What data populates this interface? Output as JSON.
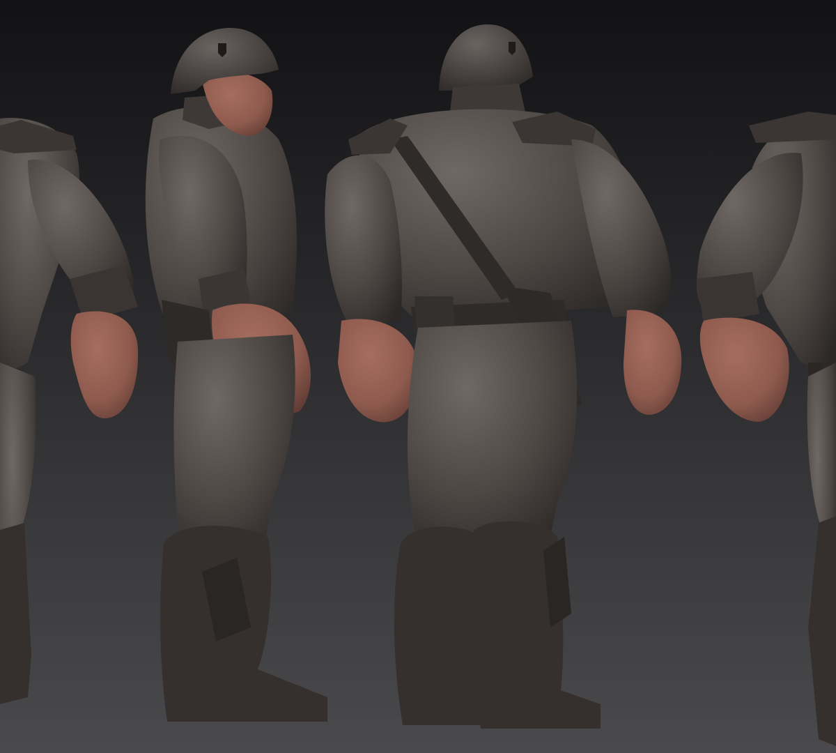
{
  "scene": {
    "background_top": "#121214",
    "background_bottom": "#4a4a4d",
    "uniform_color": "#4e4845",
    "uniform_highlight": "#6f6864",
    "uniform_shadow": "#2c2826",
    "skin_color": "#8f5b4e",
    "skin_shadow": "#5e3a33",
    "views": [
      {
        "name": "front-three-quarter-partial"
      },
      {
        "name": "side-profile"
      },
      {
        "name": "back-three-quarter"
      },
      {
        "name": "back-partial"
      }
    ]
  }
}
